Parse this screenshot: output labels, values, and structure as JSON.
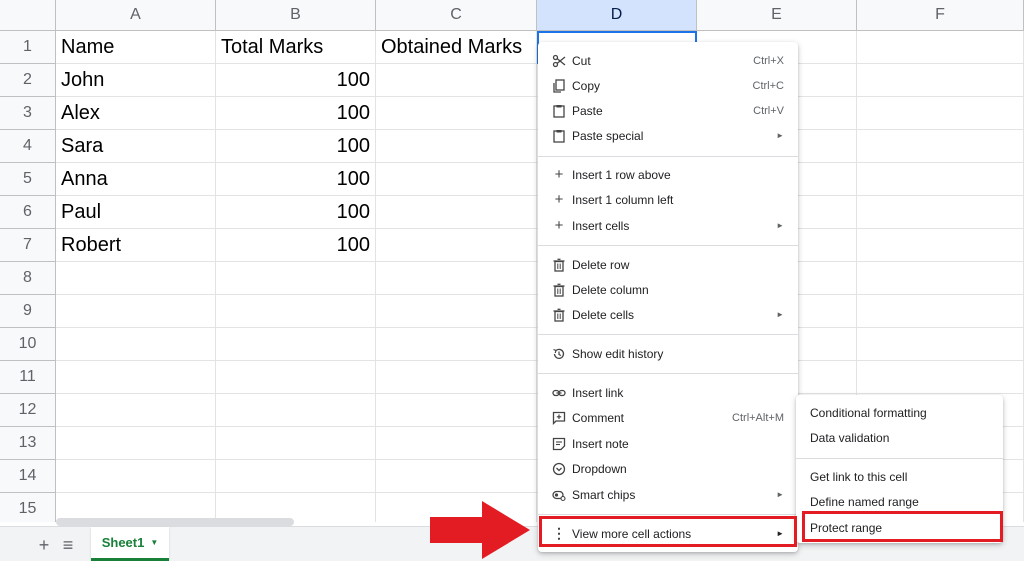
{
  "grid": {
    "columns": [
      "A",
      "B",
      "C",
      "D",
      "E",
      "F"
    ],
    "rows": [
      "1",
      "2",
      "3",
      "4",
      "5",
      "6",
      "7",
      "8",
      "9",
      "10",
      "11",
      "12",
      "13",
      "14",
      "15"
    ],
    "cells": {
      "r1": [
        "Name",
        "Total Marks",
        "Obtained Marks"
      ],
      "r2": [
        "John",
        "100"
      ],
      "r3": [
        "Alex",
        "100"
      ],
      "r4": [
        "Sara",
        "100"
      ],
      "r5": [
        "Anna",
        "100"
      ],
      "r6": [
        "Paul",
        "100"
      ],
      "r7": [
        "Robert",
        "100"
      ]
    }
  },
  "context_menu": {
    "cut": {
      "label": "Cut",
      "shortcut": "Ctrl+X"
    },
    "copy": {
      "label": "Copy",
      "shortcut": "Ctrl+C"
    },
    "paste": {
      "label": "Paste",
      "shortcut": "Ctrl+V"
    },
    "paste_special": {
      "label": "Paste special"
    },
    "insert_row_above": {
      "label": "Insert 1 row above"
    },
    "insert_column_left": {
      "label": "Insert 1 column left"
    },
    "insert_cells": {
      "label": "Insert cells"
    },
    "delete_row": {
      "label": "Delete row"
    },
    "delete_column": {
      "label": "Delete column"
    },
    "delete_cells": {
      "label": "Delete cells"
    },
    "show_edit_history": {
      "label": "Show edit history"
    },
    "insert_link": {
      "label": "Insert link"
    },
    "comment": {
      "label": "Comment",
      "shortcut": "Ctrl+Alt+M"
    },
    "insert_note": {
      "label": "Insert note"
    },
    "dropdown": {
      "label": "Dropdown"
    },
    "smart_chips": {
      "label": "Smart chips"
    },
    "view_more": {
      "label": "View more cell actions"
    }
  },
  "submenu": {
    "conditional_formatting": "Conditional formatting",
    "data_validation": "Data validation",
    "get_link": "Get link to this cell",
    "define_named_range": "Define named range",
    "protect_range": "Protect range"
  },
  "bottom_bar": {
    "add_sheet_glyph": "+",
    "all_sheets_glyph": "≡",
    "sheet_tab": "Sheet1"
  },
  "colors": {
    "highlight": "#e31c24",
    "sheet_tab_green": "#188038",
    "selection_blue": "#1a73e8"
  }
}
